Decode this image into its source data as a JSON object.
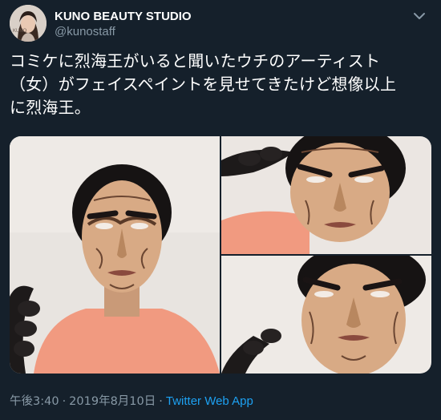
{
  "account": {
    "display_name": "KUNO BEAUTY STUDIO",
    "handle": "@kunostaff"
  },
  "tweet": {
    "lines": [
      "コミケに烈海王がいると聞いたウチのアーティスト",
      "（女）がフェイスペイントを見せてきたけど想像以上",
      "に烈海王。"
    ]
  },
  "meta": {
    "time": "午後3:40",
    "separator": "·",
    "date": "2019年8月10日",
    "source": "Twitter Web App"
  },
  "icons": {
    "menu": "chevron-down-icon"
  },
  "colors": {
    "background": "#15202b",
    "text": "#ffffff",
    "secondary": "#8899a6",
    "link": "#1da1f2"
  }
}
